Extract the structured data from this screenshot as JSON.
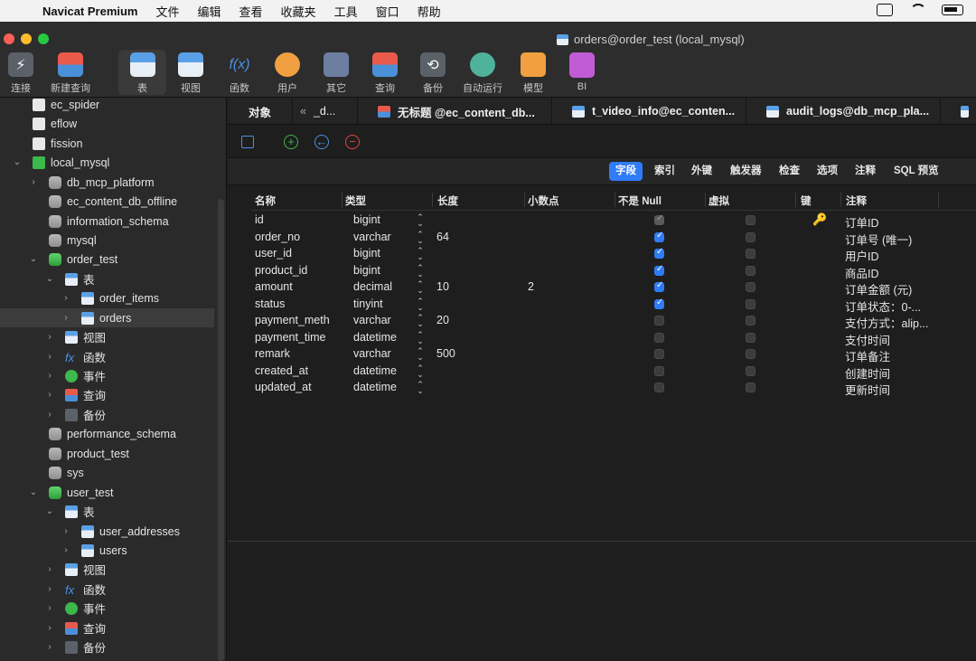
{
  "menubar": {
    "app_name": "Navicat Premium",
    "items": [
      "文件",
      "编辑",
      "查看",
      "收藏夹",
      "工具",
      "窗口",
      "帮助"
    ]
  },
  "window": {
    "title": "orders@order_test (local_mysql)"
  },
  "toolbar": {
    "items": [
      {
        "label": "连接",
        "icon": "connection-icon"
      },
      {
        "label": "新建查询",
        "icon": "new-query-icon"
      },
      {
        "label": "表",
        "icon": "table-icon"
      },
      {
        "label": "视图",
        "icon": "view-icon"
      },
      {
        "label": "函数",
        "icon": "function-icon"
      },
      {
        "label": "用户",
        "icon": "user-icon"
      },
      {
        "label": "其它",
        "icon": "other-icon"
      },
      {
        "label": "查询",
        "icon": "query-icon"
      },
      {
        "label": "备份",
        "icon": "backup-icon"
      },
      {
        "label": "自动运行",
        "icon": "automation-icon"
      },
      {
        "label": "模型",
        "icon": "model-icon"
      },
      {
        "label": "BI",
        "icon": "bi-icon"
      }
    ],
    "active": "表"
  },
  "sidebar": {
    "items": [
      {
        "label": "ec_spider"
      },
      {
        "label": "eflow"
      },
      {
        "label": "fission"
      },
      {
        "label": "local_mysql"
      },
      {
        "label": "db_mcp_platform"
      },
      {
        "label": "ec_content_db_offline"
      },
      {
        "label": "information_schema"
      },
      {
        "label": "mysql"
      },
      {
        "label": "order_test"
      },
      {
        "label": "表"
      },
      {
        "label": "order_items"
      },
      {
        "label": "orders"
      },
      {
        "label": "视图"
      },
      {
        "label": "函数"
      },
      {
        "label": "事件"
      },
      {
        "label": "查询"
      },
      {
        "label": "备份"
      },
      {
        "label": "performance_schema"
      },
      {
        "label": "product_test"
      },
      {
        "label": "sys"
      },
      {
        "label": "user_test"
      },
      {
        "label": "表"
      },
      {
        "label": "user_addresses"
      },
      {
        "label": "users"
      },
      {
        "label": "视图"
      },
      {
        "label": "函数"
      },
      {
        "label": "事件"
      },
      {
        "label": "查询"
      },
      {
        "label": "备份"
      }
    ]
  },
  "tabs": {
    "objects": "对象",
    "back": "_d...",
    "items": [
      "无标题 @ec_content_db...",
      "t_video_info@ec_conten...",
      "audit_logs@db_mcp_pla..."
    ]
  },
  "designer": {
    "subtabs": [
      "字段",
      "索引",
      "外键",
      "触发器",
      "检查",
      "选项",
      "注释",
      "SQL 预览"
    ],
    "active_subtab": "字段",
    "columns": [
      "名称",
      "类型",
      "长度",
      "小数点",
      "不是 Null",
      "虚拟",
      "键",
      "注释"
    ],
    "rows": [
      {
        "name": "id",
        "type": "bigint",
        "length": "",
        "decimals": "",
        "not_null": "dim",
        "virtual": false,
        "key": true,
        "comment": "订单ID"
      },
      {
        "name": "order_no",
        "type": "varchar",
        "length": "64",
        "decimals": "",
        "not_null": "on",
        "virtual": false,
        "key": false,
        "comment": "订单号 (唯一)"
      },
      {
        "name": "user_id",
        "type": "bigint",
        "length": "",
        "decimals": "",
        "not_null": "on",
        "virtual": false,
        "key": false,
        "comment": "用户ID"
      },
      {
        "name": "product_id",
        "type": "bigint",
        "length": "",
        "decimals": "",
        "not_null": "on",
        "virtual": false,
        "key": false,
        "comment": "商品ID"
      },
      {
        "name": "amount",
        "type": "decimal",
        "length": "10",
        "decimals": "2",
        "not_null": "on",
        "virtual": false,
        "key": false,
        "comment": "订单金额 (元)"
      },
      {
        "name": "status",
        "type": "tinyint",
        "length": "",
        "decimals": "",
        "not_null": "on",
        "virtual": false,
        "key": false,
        "comment": "订单状态：0-..."
      },
      {
        "name": "payment_meth",
        "type": "varchar",
        "length": "20",
        "decimals": "",
        "not_null": "off",
        "virtual": false,
        "key": false,
        "comment": "支付方式：alip..."
      },
      {
        "name": "payment_time",
        "type": "datetime",
        "length": "",
        "decimals": "",
        "not_null": "off",
        "virtual": false,
        "key": false,
        "comment": "支付时间"
      },
      {
        "name": "remark",
        "type": "varchar",
        "length": "500",
        "decimals": "",
        "not_null": "off",
        "virtual": false,
        "key": false,
        "comment": "订单备注"
      },
      {
        "name": "created_at",
        "type": "datetime",
        "length": "",
        "decimals": "",
        "not_null": "off",
        "virtual": false,
        "key": false,
        "comment": "创建时间"
      },
      {
        "name": "updated_at",
        "type": "datetime",
        "length": "",
        "decimals": "",
        "not_null": "off",
        "virtual": false,
        "key": false,
        "comment": "更新时间"
      }
    ]
  }
}
